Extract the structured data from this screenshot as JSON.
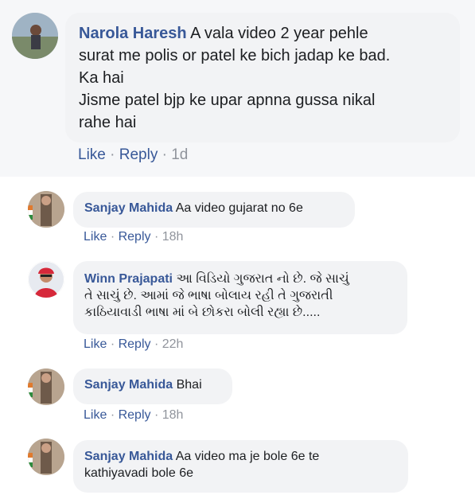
{
  "main_comment": {
    "author": "Narola Haresh",
    "lines": [
      "A vala video 2 year pehle",
      "surat me polis or patel ke bich jadap ke bad.",
      "Ka hai",
      "Jisme patel bjp ke upar apnna gussa nikal",
      "rahe hai"
    ],
    "like_label": "Like",
    "reply_label": "Reply",
    "time": "1d",
    "separator": "·"
  },
  "replies": [
    {
      "author": "Sanjay Mahida",
      "lines": [
        "Aa video gujarat no 6e"
      ],
      "like_label": "Like",
      "reply_label": "Reply",
      "time": "18h",
      "separator": "·"
    },
    {
      "author": "Winn Prajapati",
      "lines": [
        "આ વિડિયો ગુજરાત નો છે. જે સાચું",
        "તે સાચું છે. આમાં જે ભાષા બોલાય રહી તે ગુજરાતી",
        "કાઠિયાવાડી ભાષા માં બે છોકરા બોલી રહ્યા છે....."
      ],
      "like_label": "Like",
      "reply_label": "Reply",
      "time": "22h",
      "separator": "·"
    },
    {
      "author": "Sanjay Mahida",
      "lines": [
        "Bhai"
      ],
      "like_label": "Like",
      "reply_label": "Reply",
      "time": "18h",
      "separator": "·"
    },
    {
      "author": "Sanjay Mahida",
      "lines": [
        "Aa video ma je bole 6e te",
        "kathiyavadi bole 6e"
      ]
    }
  ],
  "colors": {
    "link": "#385898",
    "meta": "#90949c",
    "bubble": "#f2f3f5",
    "section_bg": "#f6f7f9"
  }
}
